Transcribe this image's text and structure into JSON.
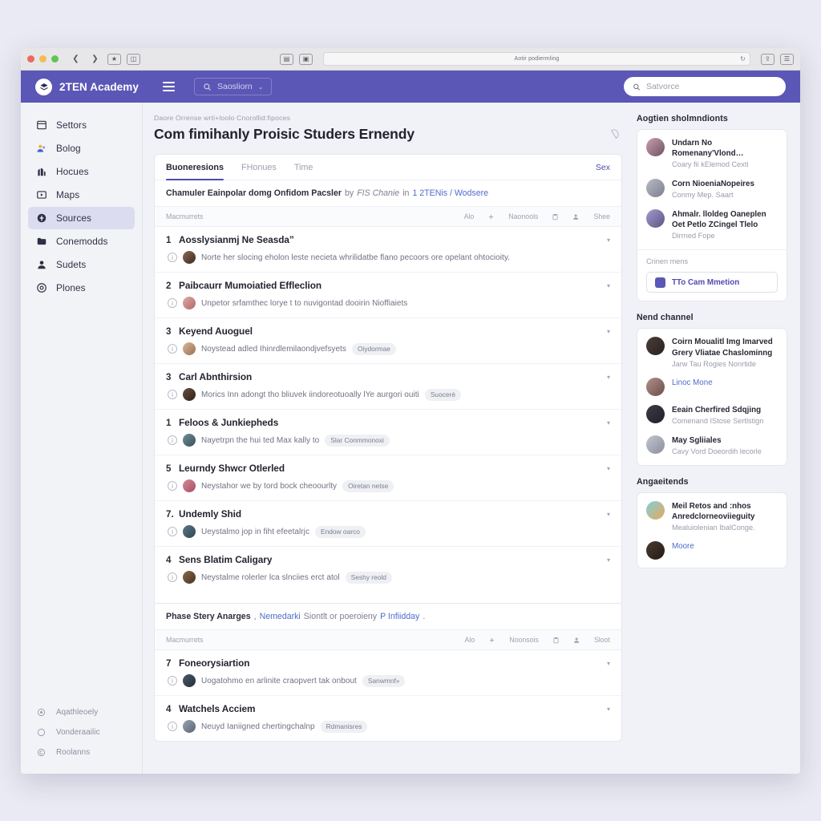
{
  "accent": "#5b57b6",
  "browser": {
    "url_text": "Aotir podiermling",
    "reload_icon": "reload-icon",
    "back_icon": "chevron-left-icon",
    "forward_icon": "chevron-right-icon",
    "bookmark_icon": "bookmark-icon",
    "sidebar_icon": "sidebar-toggle-icon",
    "tabs_icon": "tab-overview-icon",
    "save_icon": "save-icon",
    "share_icon": "share-icon",
    "menu_icon": "menu-icon"
  },
  "appbar": {
    "brand": "2TEN Academy",
    "brand_logo_icon": "academy-logo-icon",
    "hamburger_icon": "hamburger-icon",
    "nav_search_label": "Saosliorn",
    "nav_search_icon": "search-icon",
    "nav_search_caret": "⌄",
    "search_placeholder": "Satvorce",
    "search_value": "",
    "search_icon": "search-icon"
  },
  "sidebar": {
    "items": [
      {
        "label": "Settors",
        "icon": "window-icon",
        "active": false
      },
      {
        "label": "Bolog",
        "icon": "people-icon",
        "active": false
      },
      {
        "label": "Hocues",
        "icon": "building-icon",
        "active": false
      },
      {
        "label": "Maps",
        "icon": "map-frame-icon",
        "active": false
      },
      {
        "label": "Sources",
        "icon": "source-dot-icon",
        "active": true
      },
      {
        "label": "Conemodds",
        "icon": "folder-icon",
        "active": false
      },
      {
        "label": "Sudets",
        "icon": "user-icon",
        "active": false
      },
      {
        "label": "Plones",
        "icon": "target-icon",
        "active": false
      }
    ],
    "bottom_items": [
      {
        "label": "Aqathleoely",
        "icon": "circle-dot-icon"
      },
      {
        "label": "Vonderaailic",
        "icon": "circle-icon"
      },
      {
        "label": "Roolanns",
        "icon": "circle-c-icon"
      }
    ]
  },
  "main": {
    "breadcrumb": "Daore Orrense wrti+loolo Cnorollid:fipoces",
    "page_title": "Com fimihanly Proisic Studers Ernendy",
    "blob_icon": "blob-outline-icon",
    "tabs": [
      {
        "label": "Buoneresions",
        "active": true
      },
      {
        "label": "FHonues",
        "active": false
      },
      {
        "label": "Time",
        "active": false
      }
    ],
    "tab_link": "Sex",
    "columns": {
      "first": "Macmurrets",
      "rest": [
        {
          "label": "Alo",
          "icon": ""
        },
        {
          "label": "",
          "icon": "plus-icon"
        },
        {
          "label": "Naonools",
          "icon": ""
        },
        {
          "label": "",
          "icon": "clipboard-icon"
        },
        {
          "label": "",
          "icon": "person-add-icon"
        },
        {
          "label": "Shee",
          "icon": ""
        }
      ],
      "rest2": [
        {
          "label": "Alo",
          "icon": ""
        },
        {
          "label": "",
          "icon": "plus-icon"
        },
        {
          "label": "Noonsois",
          "icon": ""
        },
        {
          "label": "",
          "icon": "clipboard-icon"
        },
        {
          "label": "",
          "icon": "person-add-icon"
        },
        {
          "label": "Sloot",
          "icon": ""
        }
      ]
    },
    "sections": [
      {
        "header": {
          "bold": "Chamuler Eainpolar domg Onfidom Pacsler",
          "gray_1": "by",
          "gray_italic": "FIS Chanie",
          "gray_2": "in",
          "link": "1 2TENis / Wodsere"
        },
        "rows": [
          {
            "num": "1",
            "title": "Aosslysianmj Ne Seasda”",
            "sub": "Norte her slocing eholon leste necieta whrilidatbe flano pecoors ore opelant ohtocioity.",
            "pill": "",
            "avatar": "a1"
          },
          {
            "num": "2",
            "title": "Paibcaurr Mumoiatied Effleclion",
            "sub": "Unpetor srfamthec lorye t to nuvigontad dooirin Nioffiaiets",
            "pill": "",
            "avatar": "a2"
          },
          {
            "num": "3",
            "title": "Keyend Auoguel",
            "sub": "Noystead adled Ihinrdlemilaondjvefsyets",
            "pill": "Oiydormae",
            "avatar": "a3"
          },
          {
            "num": "3",
            "title": "Carl Abnthirsion",
            "sub": "Morics Inn adongt tho bliuvek iindoreotuoally lYe aurgori ouiti",
            "pill": "Suocerè",
            "avatar": "a4"
          },
          {
            "num": "1",
            "title": "Feloos & Junkiepheds",
            "sub": "Nayetrpn the hui ted Max kally to",
            "pill": "Slar Conmmonoxi",
            "avatar": "a5"
          },
          {
            "num": "5",
            "title": "Leurndy Shwcr Otlerled",
            "sub": "Neystahor we by tord bock cheoourlty",
            "pill": "Oiretan netse",
            "avatar": "a6"
          },
          {
            "num": "7.",
            "title": "Undemly Shid",
            "sub": "Ueystalmo jop in fiht efeetalrjc",
            "pill": "Endow oarco",
            "avatar": "a7"
          },
          {
            "num": "4",
            "title": "Sens Blatim Caligary",
            "sub": "Neystalme rolerler lca slnciies erct atol",
            "pill": "Seshy reold",
            "avatar": "a8"
          }
        ]
      },
      {
        "header": {
          "bold": "Phase Stery Anarges",
          "gray_1": ",",
          "link_a": "Nemedarki",
          "gray_2": "Siontlt or poeroieny",
          "link_b": "P Infiidday",
          "gray_3": "."
        },
        "rows": [
          {
            "num": "7",
            "title": "Foneorysiartion",
            "sub": "Uogatohmo en arlinite craopvert tak onbout",
            "pill": "Sanwmnf»",
            "avatar": "a9"
          },
          {
            "num": "4",
            "title": "Watchels Acciem",
            "sub": "Neuyd Ianiigned chertingchalnp",
            "pill": "Rdmanisres",
            "avatar": "a10"
          }
        ]
      }
    ]
  },
  "rail": {
    "groups": [
      {
        "title": "Aogtien sholmndionts",
        "items": [
          {
            "t1": "Undarn No Romenany'Vlond…",
            "t2": "Coary fii kElemod Cexti",
            "avatar": "g1",
            "link": false
          },
          {
            "t1": "Corn NioeniaNopeires",
            "t2": "Conmy Mep. Saart",
            "avatar": "g2",
            "link": false
          },
          {
            "t1": "Ahmalr. lloldeg Oaneplen Oet Petlo ZCingel Tlelo",
            "t2": "Dirrned Fope",
            "avatar": "g3",
            "link": false
          }
        ],
        "divider": true,
        "sublabel": "Crinen mens",
        "button": {
          "label": "TTo Cam Mmetion",
          "icon": "app-square-icon"
        }
      },
      {
        "title": "Nend channel",
        "items": [
          {
            "t1": "Coirn Moualitl Img Imarved Grery Vliatae Chaslominng",
            "t2": "Jarw Tau Rogies Nonrtide",
            "avatar": "g4",
            "link": false
          },
          {
            "t1": "Linoc Mone",
            "t2": "",
            "avatar": "g5",
            "link": true
          },
          {
            "t1": "Eeain Cherfired Sdqjing",
            "t2": "Comenand IStose Sertlstign",
            "avatar": "g6",
            "link": false
          },
          {
            "t1": "May Sgliiales",
            "t2": "Cavy Vord Doeordih lecorle",
            "avatar": "g7",
            "link": false
          }
        ],
        "divider": false,
        "sublabel": "",
        "button": null
      },
      {
        "title": "Angaeitends",
        "items": [
          {
            "t1": "Meil Retos and :nhos Anredclorneoviieguity",
            "t2": "Mealuiolenian IbalConge.",
            "avatar": "g8",
            "link": false
          },
          {
            "t1": "Moore",
            "t2": "",
            "avatar": "g9",
            "link": true
          }
        ],
        "divider": false,
        "sublabel": "",
        "button": null
      }
    ]
  }
}
